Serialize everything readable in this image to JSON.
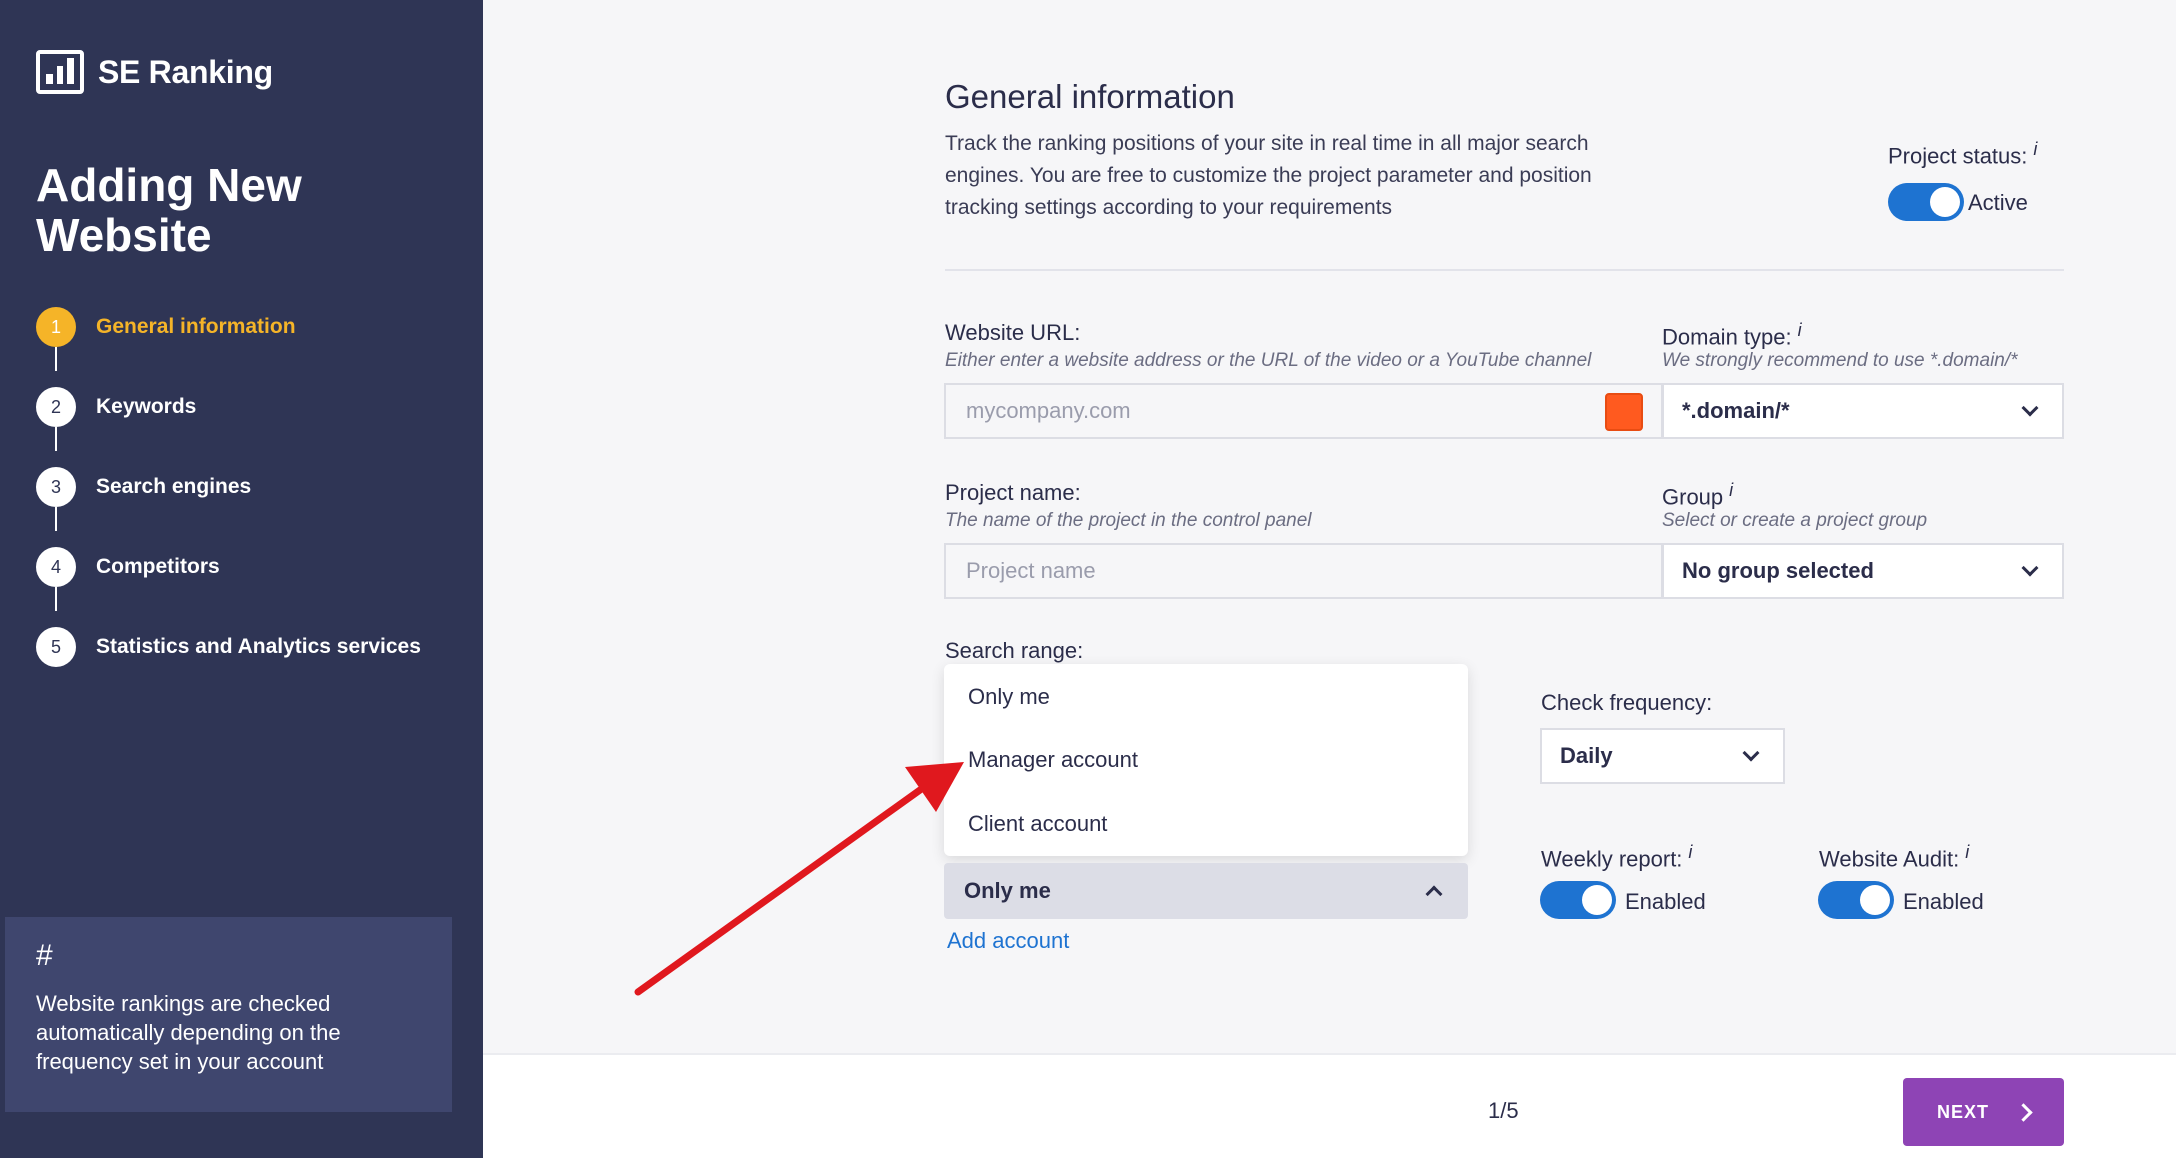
{
  "app": {
    "logo_text": "SE Ranking"
  },
  "sidebar": {
    "title": "Adding New Website",
    "steps": [
      {
        "num": "1",
        "label": "General information",
        "active": true
      },
      {
        "num": "2",
        "label": "Keywords"
      },
      {
        "num": "3",
        "label": "Search engines"
      },
      {
        "num": "4",
        "label": "Competitors"
      },
      {
        "num": "5",
        "label": "Statistics and Analytics services"
      }
    ],
    "tip": {
      "hash": "#",
      "text": "Website rankings are checked automatically depending on the frequency set in your account"
    }
  },
  "main": {
    "title": "General information",
    "description": "Track the ranking positions of your site in real time in all major search engines. You are free to customize the project parameter and position tracking settings according to your requirements",
    "project_status": {
      "label": "Project status:",
      "info": "i",
      "value": "Active"
    },
    "website_url": {
      "label": "Website URL:",
      "hint": "Either enter a website address or the URL of the video or a YouTube channel",
      "placeholder": "mycompany.com",
      "swatch_color": "#ff5a1f"
    },
    "domain_type": {
      "label": "Domain type:",
      "info": "i",
      "hint": "We strongly recommend to use *.domain/*",
      "value": "*.domain/*"
    },
    "project_name": {
      "label": "Project name:",
      "hint": "The name of the project in the control panel",
      "placeholder": "Project name"
    },
    "group": {
      "label": "Group",
      "info": "i",
      "hint": "Select or create a project group",
      "value": "No group selected"
    },
    "search_range": {
      "label": "Search range:",
      "options": [
        "Only me",
        "Manager account",
        "Client account"
      ],
      "value": "Only me",
      "add_account": "Add account"
    },
    "check_frequency": {
      "label": "Check frequency:",
      "value": "Daily"
    },
    "weekly_report": {
      "label": "Weekly report:",
      "info": "i",
      "value": "Enabled"
    },
    "website_audit": {
      "label": "Website Audit:",
      "info": "i",
      "value": "Enabled"
    }
  },
  "footer": {
    "pager": "1/5",
    "next_label": "NEXT"
  },
  "colors": {
    "sidebar_bg": "#2f3555",
    "accent": "#f5b428",
    "toggle": "#1e73d1",
    "next_button": "#8e44b5",
    "annotation_arrow": "#e0181e"
  }
}
